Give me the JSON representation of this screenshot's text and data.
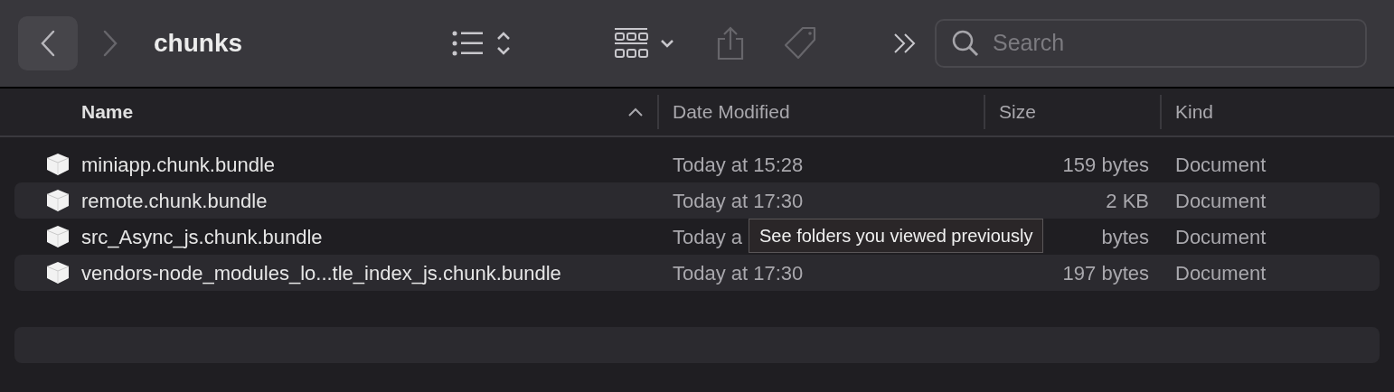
{
  "toolbar": {
    "title": "chunks",
    "search": {
      "placeholder": "Search"
    }
  },
  "columns": [
    {
      "label": "Name",
      "sorted": true
    },
    {
      "label": "Date Modified",
      "sorted": false
    },
    {
      "label": "Size",
      "sorted": false
    },
    {
      "label": "Kind",
      "sorted": false
    }
  ],
  "rows": [
    {
      "name": "miniapp.chunk.bundle",
      "date": "Today at 15:28",
      "size": "159 bytes",
      "kind": "Document"
    },
    {
      "name": "remote.chunk.bundle",
      "date": "Today at 17:30",
      "size": "2 KB",
      "kind": "Document"
    },
    {
      "name": "src_Async_js.chunk.bundle",
      "date": "Today a",
      "size": "bytes",
      "kind": "Document"
    },
    {
      "name": "vendors-node_modules_lo...tle_index_js.chunk.bundle",
      "date": "Today at 17:30",
      "size": "197 bytes",
      "kind": "Document"
    }
  ],
  "tooltip": "See folders you viewed previously"
}
